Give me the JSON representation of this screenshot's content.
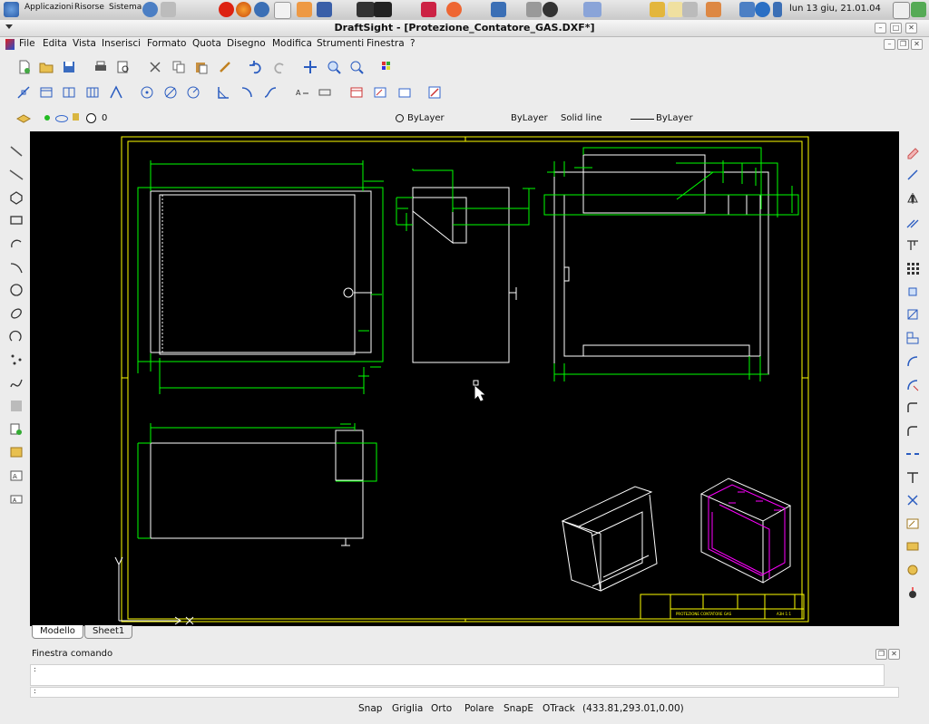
{
  "taskbar": {
    "menus": [
      "Applicazioni",
      "Risorse",
      "Sistema"
    ],
    "clock": "lun 13 giu, 21.01.04"
  },
  "window": {
    "title": "DraftSight - [Protezione_Contatore_GAS.DXF*]"
  },
  "menubar": {
    "items": [
      "File",
      "Edita",
      "Vista",
      "Inserisci",
      "Formato",
      "Quota",
      "Disegno",
      "Modifica",
      "Strumenti",
      "Finestra",
      "?"
    ]
  },
  "properties": {
    "layer": "0",
    "color": "ByLayer",
    "linetype_layer": "ByLayer",
    "linetype": "Solid line",
    "lineweight": "ByLayer"
  },
  "tabs": [
    "Modello",
    "Sheet1"
  ],
  "command_window": {
    "title": "Finestra comando",
    "prompt": ":"
  },
  "status": {
    "items": [
      "Snap",
      "Griglia",
      "Orto",
      "Polare",
      "SnapE",
      "OTrack"
    ],
    "coordinates": "(433.81,293.01,0.00)"
  },
  "drawing": {
    "title_block_text": "PROTEZIONE CONTATORE GAS",
    "title_block_scale": "A3H 1:1",
    "colors": {
      "background": "#000000",
      "geometry": "#ffffff",
      "dimensions": "#00ff00",
      "frame": "#ffff00",
      "highlight": "#ff00ff"
    }
  }
}
